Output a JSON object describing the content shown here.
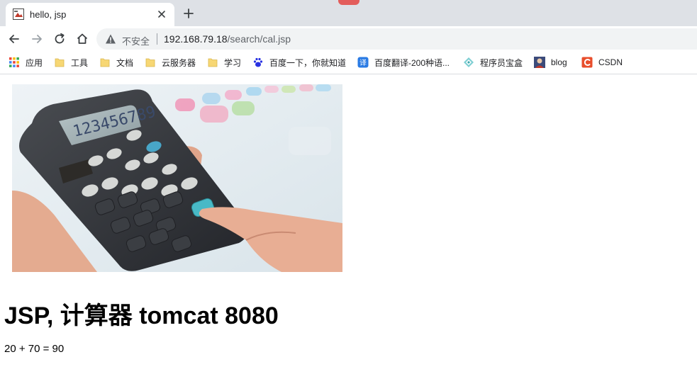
{
  "browser": {
    "tab": {
      "title": "hello, jsp",
      "favicon": "image-favicon-icon"
    },
    "address": {
      "security_label": "不安全",
      "host": "192.168.79.18",
      "path": "/search/cal.jsp"
    }
  },
  "bookmarks": [
    {
      "label": "应用",
      "icon": "apps-grid-icon"
    },
    {
      "label": "工具",
      "icon": "folder-icon"
    },
    {
      "label": "文档",
      "icon": "folder-icon"
    },
    {
      "label": "云服务器",
      "icon": "folder-icon"
    },
    {
      "label": "学习",
      "icon": "folder-icon"
    },
    {
      "label": "百度一下，你就知道",
      "icon": "baidu-paw-icon"
    },
    {
      "label": "百度翻译-200种语...",
      "icon": "translate-icon"
    },
    {
      "label": "程序员宝盒",
      "icon": "diamond-icon"
    },
    {
      "label": "blog",
      "icon": "avatar-icon"
    },
    {
      "label": "CSDN",
      "icon": "csdn-icon"
    }
  ],
  "page": {
    "image": "calculator-photo",
    "calculator_display": "123456789",
    "heading": "JSP, 计算器 tomcat 8080",
    "result": "20 + 70 = 90"
  },
  "colors": {
    "tabstrip": "#dee1e6",
    "omnibox": "#f1f3f4",
    "folder": "#f7d774",
    "top_mark": "#e35d5b"
  }
}
